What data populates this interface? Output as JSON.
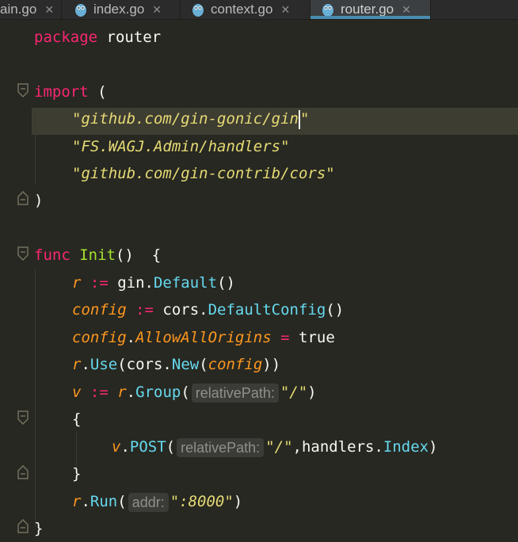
{
  "tabs": [
    {
      "label": "ain.go",
      "active": false
    },
    {
      "label": "index.go",
      "active": false
    },
    {
      "label": "context.go",
      "active": false
    },
    {
      "label": "router.go",
      "active": true
    }
  ],
  "code": {
    "l1": {
      "kw": "package",
      "rest": " router"
    },
    "l3": {
      "kw": "import",
      "rest": " ("
    },
    "l4": {
      "str": "\"github.com/gin-gonic/gin",
      "q": "\""
    },
    "l5": {
      "str": "\"FS.WAGJ.Admin/handlers\""
    },
    "l6": {
      "str": "\"github.com/gin-contrib/cors\""
    },
    "l7": {
      "text": ")"
    },
    "l9": {
      "kw": "func",
      "fn": "Init",
      "rest": "()  {"
    },
    "l10": {
      "v": "r",
      "op": " := ",
      "pkg": "gin.",
      "call": "Default",
      "rest": "()"
    },
    "l11": {
      "v": "config",
      "op": " := ",
      "pkg": "cors.",
      "call": "DefaultConfig",
      "rest": "()"
    },
    "l12": {
      "v": "config",
      "dot": ".",
      "field": "AllowAllOrigins",
      "op": " = ",
      "val": "true"
    },
    "l13": {
      "v": "r",
      "dot": ".",
      "call": "Use",
      "p1": "(cors.",
      "call2": "New",
      "p2": "(",
      "arg": "config",
      "p3": "))"
    },
    "l14": {
      "v": "v",
      "op": " := ",
      "v2": "r",
      "dot": ".",
      "call": "Group",
      "p1": "(",
      "hint": "relativePath:",
      "str": "\"/\"",
      "p2": ")"
    },
    "l15": {
      "text": "{"
    },
    "l16": {
      "v": "v",
      "dot": ".",
      "call": "POST",
      "p1": "(",
      "hint": "relativePath:",
      "str": "\"/\"",
      "p2": ",handlers.",
      "call2": "Index",
      "p3": ")"
    },
    "l17": {
      "text": "}"
    },
    "l18": {
      "v": "r",
      "dot": ".",
      "call": "Run",
      "p1": "(",
      "hint": "addr:",
      "str": "\":8000\"",
      "p2": ")"
    },
    "l19": {
      "text": "}"
    }
  },
  "colors": {
    "background": "#272822",
    "keyword": "#f92672",
    "string": "#e6db74",
    "function": "#a6e22e",
    "call": "#66d9ef",
    "variable": "#fd971f",
    "accent": "#4a8cb0"
  }
}
